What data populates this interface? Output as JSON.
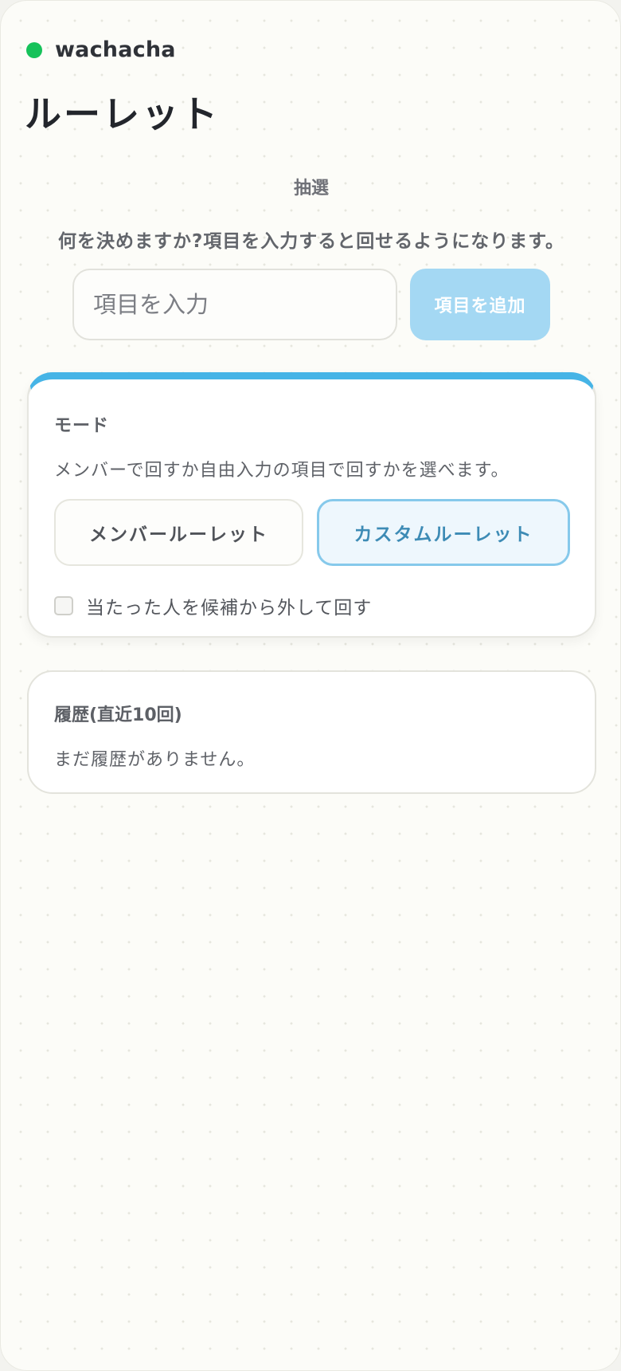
{
  "brand": {
    "name": "wachacha",
    "status_color": "#16c25a"
  },
  "page": {
    "title": "ルーレット",
    "section_label": "抽選",
    "description": "何を決めますか?項目を入力すると回せるようになります。"
  },
  "input": {
    "placeholder": "項目を入力",
    "value": "",
    "add_button_label": "項目を追加"
  },
  "mode": {
    "title": "モード",
    "description": "メンバーで回すか自由入力の項目で回すかを選べます。",
    "options": [
      {
        "label": "メンバールーレット",
        "selected": false
      },
      {
        "label": "カスタムルーレット",
        "selected": true
      }
    ],
    "exclude_winner": {
      "label": "当たった人を候補から外して回す",
      "checked": false
    }
  },
  "history": {
    "title": "履歴(直近10回)",
    "empty_message": "まだ履歴がありません。"
  },
  "colors": {
    "accent": "#46b4e6",
    "add_button": "#a4d8f3",
    "selected_mode_border": "#86c9eb",
    "selected_mode_text": "#3d8bb5"
  }
}
